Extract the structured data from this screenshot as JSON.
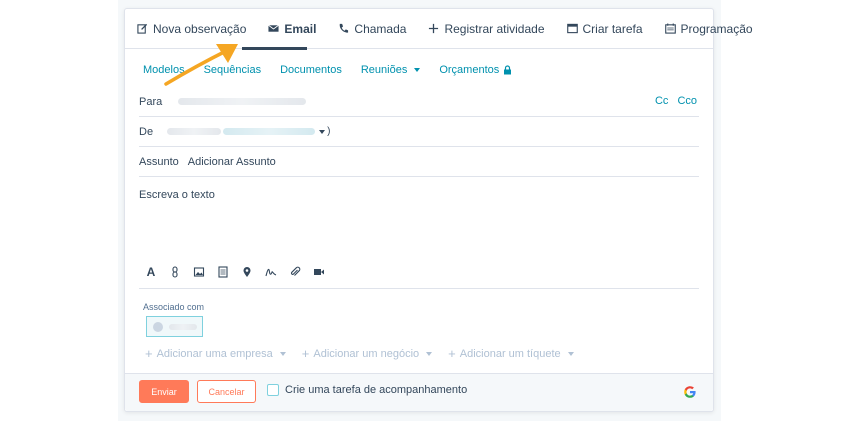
{
  "tabs": [
    {
      "label": "Nova observação",
      "icon": "edit-icon"
    },
    {
      "label": "Email",
      "icon": "email-icon"
    },
    {
      "label": "Chamada",
      "icon": "phone-icon"
    },
    {
      "label": "Registrar atividade",
      "icon": "plus-icon"
    },
    {
      "label": "Criar tarefa",
      "icon": "task-icon"
    },
    {
      "label": "Programação",
      "icon": "calendar-icon"
    }
  ],
  "active_tab": "Email",
  "subbar": {
    "templates": "Modelos",
    "sequences": "Sequências",
    "documents": "Documentos",
    "meetings": "Reuniões",
    "quotes": "Orçamentos"
  },
  "fields": {
    "to_label": "Para",
    "from_label": "De",
    "subject_label": "Assunto",
    "subject_placeholder": "Adicionar Assunto",
    "cc": "Cc",
    "bcc": "Cco"
  },
  "body_placeholder": "Escreva o texto",
  "association": {
    "label": "Associado com"
  },
  "add_actions": {
    "company": "Adicionar uma empresa",
    "deal": "Adicionar um negócio",
    "ticket": "Adicionar um tíquete"
  },
  "footer": {
    "send": "Enviar",
    "cancel": "Cancelar",
    "followup": "Crie uma tarefa de acompanhamento"
  },
  "colors": {
    "accent": "#ff7a59",
    "link": "#0091ae",
    "arrow": "#f5a623",
    "text": "#33475b"
  }
}
